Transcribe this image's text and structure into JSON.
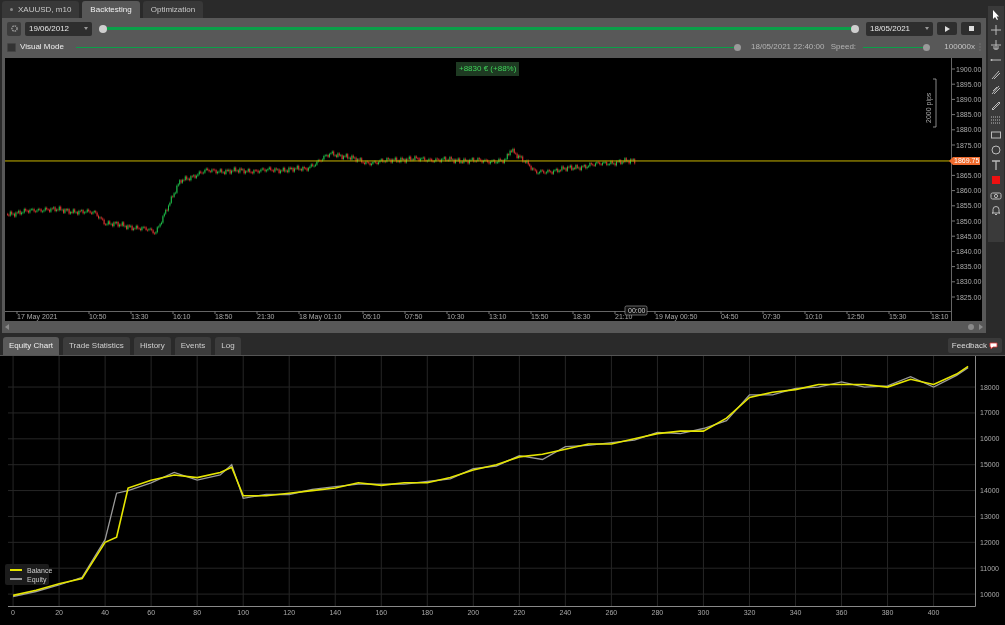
{
  "tabs": [
    {
      "label": "XAUUSD, m10",
      "selected": false,
      "kind": "document"
    },
    {
      "label": "Backtesting",
      "selected": true,
      "kind": "mode"
    },
    {
      "label": "Optimization",
      "selected": false,
      "kind": "mode"
    }
  ],
  "backtest_bar": {
    "start_date": "19/06/2012",
    "end_date": "18/05/2021",
    "level": 1
  },
  "visual_mode": {
    "label": "Visual Mode",
    "checked": false,
    "level": 1,
    "timestamp": "18/05/2021 22:40:00",
    "speed_label": "Speed:",
    "speed": {
      "level": 1,
      "reading": "100000x"
    }
  },
  "price_chart": {
    "profit_badge": "+8830 € (+88%)",
    "range_label": "2000 pips",
    "price_ticks": [
      "1900.00",
      "1895.00",
      "1890.00",
      "1885.00",
      "1880.00",
      "1875.00",
      "1865.00",
      "1860.00",
      "1855.00",
      "1850.00",
      "1845.00",
      "1840.00",
      "1835.00",
      "1830.00",
      "1825.00"
    ],
    "current_price": "1869.75",
    "time_labels": [
      "17 May 2021",
      "10:50",
      "13:30",
      "16:10",
      "18:50",
      "21:30",
      "18 May 01:10",
      "05:10",
      "07:50",
      "10:30",
      "13:10",
      "15:50",
      "18:30",
      "21:10",
      "19 May 00:50",
      "04:50",
      "07:30",
      "10:10",
      "12:50",
      "15:30",
      "18:10"
    ],
    "cursor_time": "00:00"
  },
  "bottom_tabs": [
    {
      "label": "Equity Chart",
      "selected": true
    },
    {
      "label": "Trade Statistics",
      "selected": false
    },
    {
      "label": "History",
      "selected": false
    },
    {
      "label": "Events",
      "selected": false
    },
    {
      "label": "Log",
      "selected": false
    }
  ],
  "feedback": "Feedback",
  "equity_chart": {
    "chart_data": {
      "type": "line",
      "x": [
        0,
        10,
        20,
        30,
        40,
        45,
        50,
        60,
        70,
        80,
        90,
        95,
        100,
        110,
        120,
        130,
        140,
        150,
        160,
        170,
        180,
        190,
        200,
        210,
        220,
        230,
        240,
        250,
        260,
        270,
        280,
        290,
        300,
        310,
        320,
        330,
        340,
        350,
        360,
        370,
        380,
        390,
        400,
        410,
        415
      ],
      "series": [
        {
          "name": "Balance",
          "color": "#e6e600",
          "values": [
            9950,
            10150,
            10400,
            10600,
            12000,
            12200,
            14100,
            14400,
            14600,
            14500,
            14700,
            14900,
            13800,
            13800,
            13900,
            14000,
            14100,
            14300,
            14200,
            14300,
            14300,
            14500,
            14800,
            15000,
            15300,
            15400,
            15600,
            15800,
            15800,
            16000,
            16200,
            16300,
            16300,
            16800,
            17600,
            17800,
            17900,
            18100,
            18100,
            18100,
            18000,
            18300,
            18100,
            18500,
            18800
          ]
        },
        {
          "name": "Equity",
          "color": "#9a9a9a",
          "values": [
            9900,
            10100,
            10350,
            10650,
            12100,
            13900,
            14000,
            14300,
            14700,
            14400,
            14600,
            15000,
            13700,
            13850,
            13850,
            14050,
            14150,
            14250,
            14250,
            14250,
            14350,
            14450,
            14850,
            14950,
            15350,
            15200,
            15700,
            15750,
            15850,
            15950,
            16250,
            16200,
            16400,
            16700,
            17700,
            17700,
            17950,
            18000,
            18200,
            18000,
            18050,
            18400,
            18000,
            18450,
            18750
          ]
        }
      ],
      "grid": true,
      "legend": "lower left",
      "xlim": [
        -2.2,
        418
      ],
      "ylim": [
        9540,
        19200
      ],
      "xticks": [
        0,
        20,
        40,
        60,
        80,
        100,
        120,
        140,
        160,
        180,
        200,
        220,
        240,
        260,
        280,
        300,
        320,
        340,
        360,
        380,
        400
      ],
      "yticks": [
        10000,
        11000,
        12000,
        13000,
        14000,
        15000,
        16000,
        17000,
        18000
      ]
    }
  }
}
